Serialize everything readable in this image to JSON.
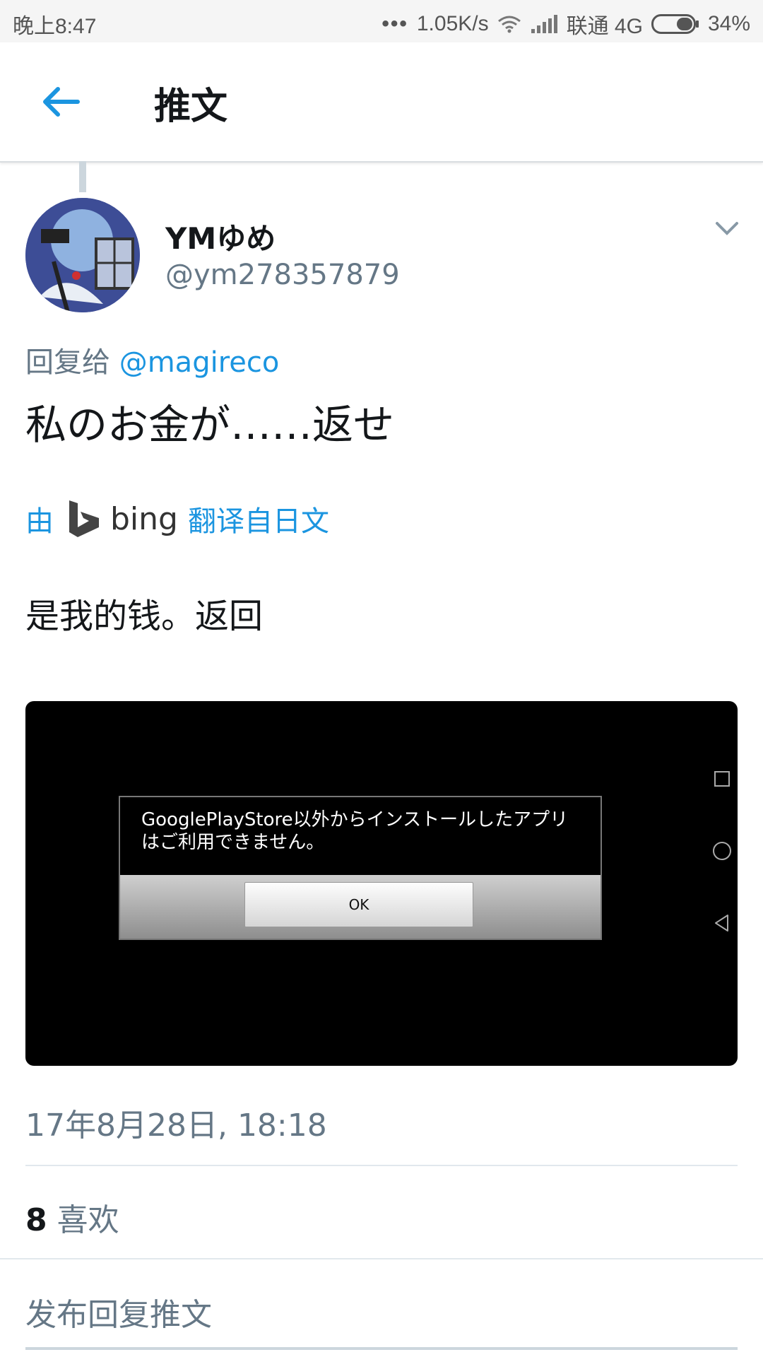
{
  "status_bar": {
    "time": "晚上8:47",
    "dots": "•••",
    "speed": "1.05K/s",
    "carrier": "联通 4G",
    "battery": "34%"
  },
  "header": {
    "title": "推文",
    "back_icon": "arrow-left-icon"
  },
  "tweet": {
    "display_name": "YMゆめ",
    "handle": "@ym278357879",
    "reply_prefix": "回复给",
    "reply_mention": "@magireco",
    "text": "私のお金が……返せ",
    "translate_prefix": "由",
    "translate_brand": "bing",
    "translate_suffix": "翻译自日文",
    "translated_text": "是我的钱。返回",
    "media": {
      "dialog_message": "GooglePlayStore以外からインストールしたアプリはご利用できません。",
      "ok_label": "OK"
    },
    "timestamp": "17年8月28日, 18:18",
    "likes_count": "8",
    "likes_label": "喜欢",
    "reply_placeholder": "发布回复推文"
  },
  "colors": {
    "accent": "#1b95e0",
    "secondary_text": "#657786",
    "primary_text": "#14171a"
  }
}
